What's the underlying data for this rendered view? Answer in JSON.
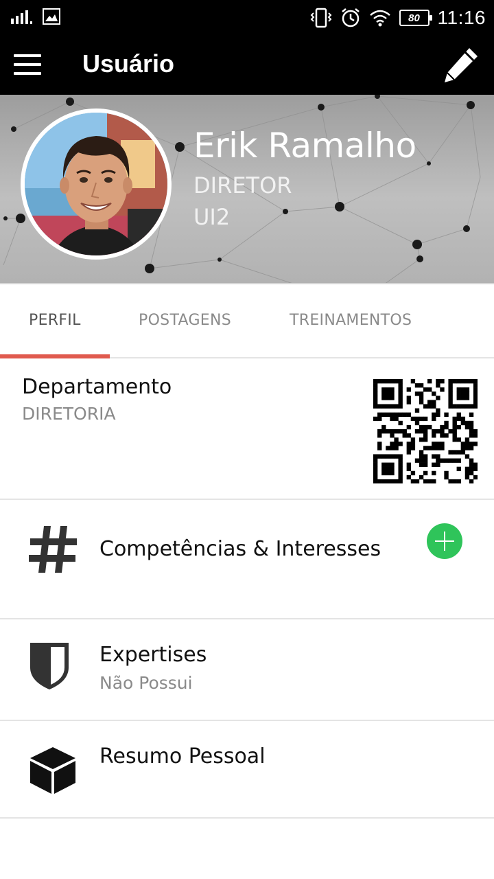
{
  "status_bar": {
    "time": "11:16",
    "battery": "80",
    "icons": [
      "signal-icon",
      "image-icon",
      "vibrate-icon",
      "alarm-icon",
      "wifi-icon",
      "battery-icon"
    ]
  },
  "app_bar": {
    "title": "Usuário",
    "menu_icon": "menu-icon",
    "edit_icon": "pencil-icon"
  },
  "profile": {
    "name": "Erik Ramalho",
    "role": "DIRETOR",
    "company": "UI2"
  },
  "tabs": [
    {
      "label": "PERFIL",
      "active": true
    },
    {
      "label": "POSTAGENS",
      "active": false
    },
    {
      "label": "TREINAMENTOS",
      "active": false
    }
  ],
  "department": {
    "label": "Departamento",
    "value": "DIRETORIA"
  },
  "sections": {
    "competencias": {
      "title": "Competências & Interesses",
      "icon": "hash-icon"
    },
    "expertises": {
      "title": "Expertises",
      "subtitle": "Não Possui",
      "icon": "shield-icon"
    },
    "resumo": {
      "title": "Resumo Pessoal",
      "icon": "cube-icon"
    }
  },
  "colors": {
    "tab_indicator": "#e05a4e",
    "add_button": "#2fc45a",
    "app_bar": "#000000"
  }
}
